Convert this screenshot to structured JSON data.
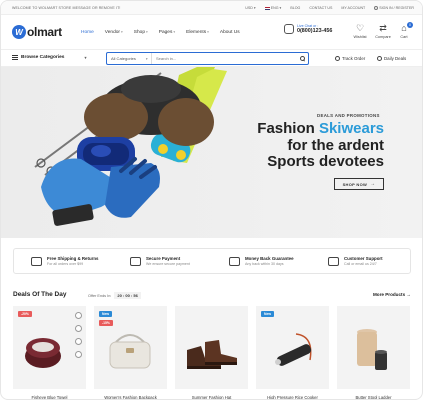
{
  "topbar": {
    "welcome": "Welcome to Wolmart Store message or remove it!",
    "currency": "USD",
    "language": "ENG",
    "links": [
      "Blog",
      "Contact Us",
      "My Account",
      "Sign In / Register"
    ]
  },
  "header": {
    "logo_mark": "W",
    "logo_text": "olmart",
    "nav": [
      {
        "label": "Home",
        "dropdown": false,
        "active": true
      },
      {
        "label": "Vendor",
        "dropdown": true
      },
      {
        "label": "Shop",
        "dropdown": true
      },
      {
        "label": "Pages",
        "dropdown": true
      },
      {
        "label": "Elements",
        "dropdown": true
      },
      {
        "label": "About Us",
        "dropdown": false
      }
    ],
    "call_label": "Live Chat or :",
    "phone": "0(800)123-456",
    "wishlist": "Wishlist",
    "compare": "Compare",
    "cart": "Cart",
    "cart_count": "0"
  },
  "catbar": {
    "browse": "Browse Categories",
    "search_category": "All Categories",
    "search_placeholder": "Search in...",
    "track_order": "Track Order",
    "daily_deals": "Daily Deals"
  },
  "hero": {
    "eyebrow": "DEALS AND PROMOTIONS",
    "line1_a": "Fashion ",
    "line1_b": "Skiwears",
    "line2": "for the ardent",
    "line3": "Sports devotees",
    "button": "SHOP NOW",
    "accent_color": "#2b9bd8"
  },
  "features": [
    {
      "title": "Free Shipping & Returns",
      "sub": "For all orders over $99",
      "icon": "truck-icon"
    },
    {
      "title": "Secure Payment",
      "sub": "We ensure secure payment",
      "icon": "wallet-icon"
    },
    {
      "title": "Money Back Guarantee",
      "sub": "Any back within 30 days",
      "icon": "money-icon"
    },
    {
      "title": "Customer Support",
      "sub": "Call or email us 24/7",
      "icon": "chat-icon"
    }
  ],
  "deals": {
    "title": "Deals Of The Day",
    "offer_label": "Offer Ends In:",
    "timer": "20 : 00 : 56",
    "more": "More Products →"
  },
  "products": [
    {
      "name": "Fisheye Blue Towel",
      "tags": [
        "-20%"
      ]
    },
    {
      "name": "Women's Fashion Backpack",
      "tags": [
        "New",
        "-15%"
      ]
    },
    {
      "name": "Summer Fashion Hat",
      "tags": []
    },
    {
      "name": "High Pressure Rice Cooker",
      "tags": [
        "New"
      ]
    },
    {
      "name": "Butter Stool Ladder",
      "tags": []
    }
  ],
  "colors": {
    "brand": "#2b6cd4",
    "sale": "#e85b5b",
    "new": "#2b8ad6"
  }
}
